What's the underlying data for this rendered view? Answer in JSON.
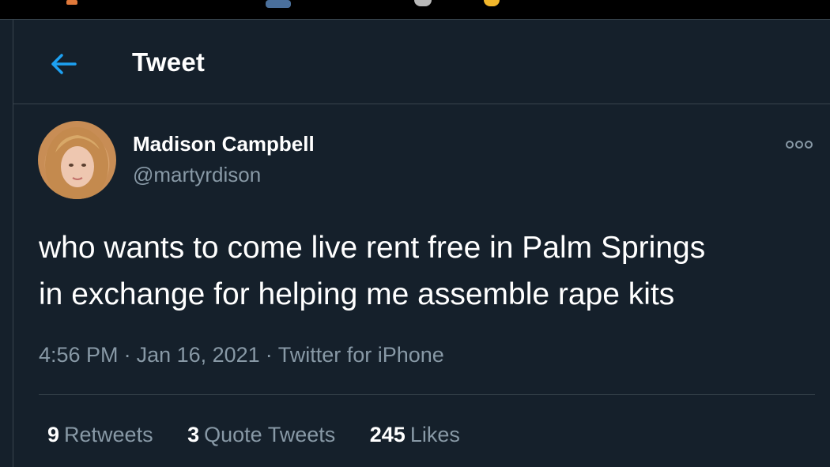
{
  "header": {
    "title": "Tweet",
    "back_icon": "arrow-left-icon"
  },
  "tweet": {
    "author": {
      "display_name": "Madison Campbell",
      "handle": "@martyrdison"
    },
    "text_lines": [
      "who wants to come live rent free in Palm Springs",
      "in exchange for helping me assemble rape kits"
    ],
    "meta": {
      "time": "4:56 PM",
      "date": "Jan 16, 2021",
      "source": "Twitter for iPhone",
      "separator": "·"
    },
    "stats": {
      "retweets": {
        "count": "9",
        "label": "Retweets"
      },
      "quote_tweets": {
        "count": "3",
        "label": "Quote Tweets"
      },
      "likes": {
        "count": "245",
        "label": "Likes"
      }
    },
    "more_icon": "more-options-icon"
  },
  "colors": {
    "background": "#15202b",
    "border": "#38444d",
    "secondary_text": "#8899a6",
    "accent": "#1da1f2",
    "primary_text": "#ffffff"
  }
}
